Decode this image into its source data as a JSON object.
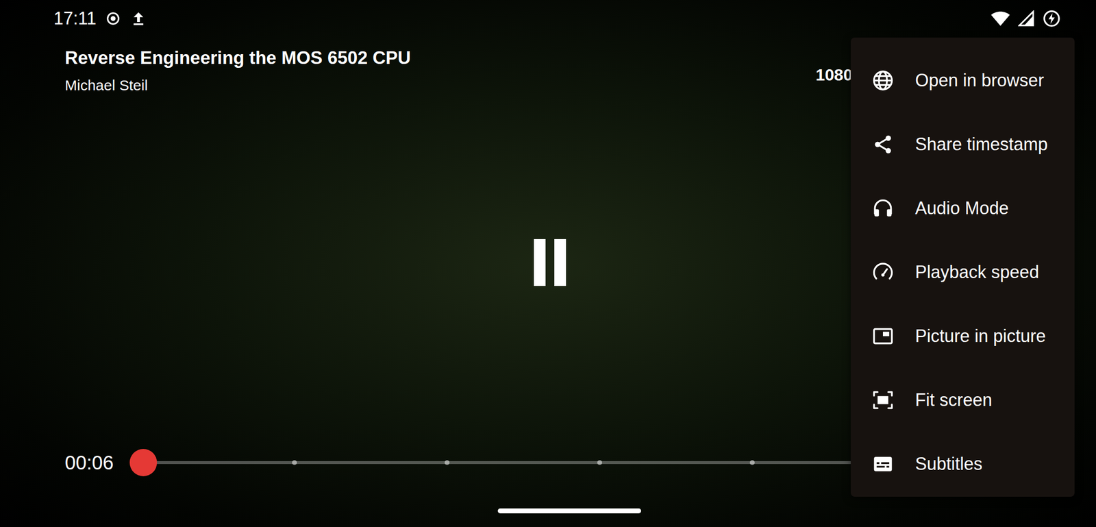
{
  "status_bar": {
    "time": "17:11"
  },
  "video": {
    "title": "Reverse Engineering the MOS 6502 CPU",
    "channel": "Michael Steil",
    "quality": "1080",
    "playing": true
  },
  "seek": {
    "position": "00:06",
    "level": 0.002,
    "markers": [
      0.2,
      0.4,
      0.6,
      0.8
    ]
  },
  "menu": {
    "items": [
      {
        "label": "Open in browser"
      },
      {
        "label": "Share timestamp"
      },
      {
        "label": "Audio Mode"
      },
      {
        "label": "Playback speed"
      },
      {
        "label": "Picture in picture"
      },
      {
        "label": "Fit screen"
      },
      {
        "label": "Subtitles"
      }
    ]
  }
}
